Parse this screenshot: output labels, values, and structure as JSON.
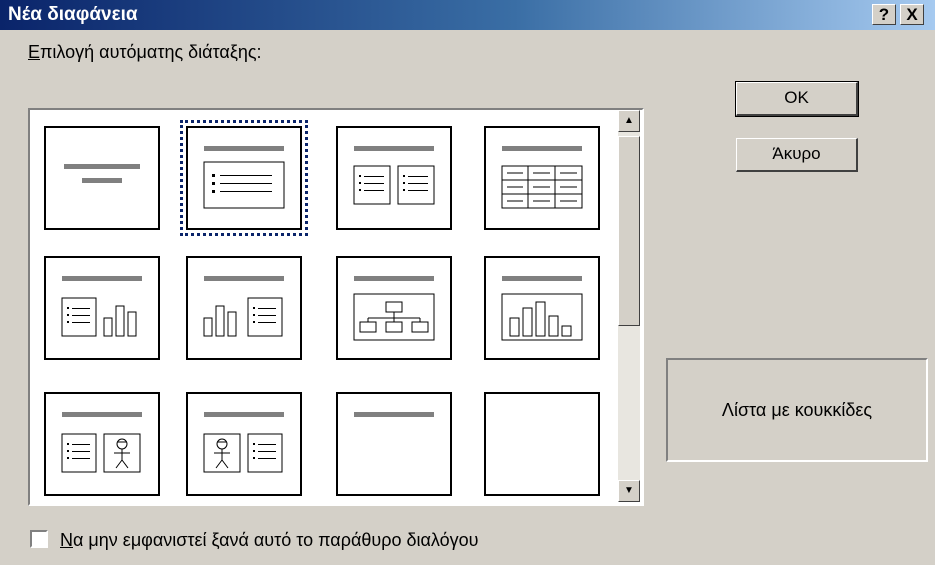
{
  "dialog": {
    "title": "Νέα διαφάνεια",
    "help_glyph": "?",
    "close_glyph": "X",
    "layout_label_accel": "Ε",
    "layout_label_rest": "πιλογή αυτόματης διάταξης:",
    "ok_label": "OK",
    "cancel_label": "Άκυρο",
    "selected_layout_name": "Λίστα με κουκκίδες",
    "checkbox_checked": false,
    "checkbox_label_accel": "Ν",
    "checkbox_label_rest": "α μην εμφανιστεί ξανά αυτό το παράθυρο διαλόγου"
  },
  "layouts": [
    {
      "kind": "title-slide",
      "selected": false
    },
    {
      "kind": "bulleted-list",
      "selected": true
    },
    {
      "kind": "two-column-text",
      "selected": false
    },
    {
      "kind": "table",
      "selected": false
    },
    {
      "kind": "text-and-chart",
      "selected": false
    },
    {
      "kind": "chart-and-text",
      "selected": false
    },
    {
      "kind": "organization-chart",
      "selected": false
    },
    {
      "kind": "chart",
      "selected": false
    },
    {
      "kind": "text-and-clip-art",
      "selected": false
    },
    {
      "kind": "clip-art-and-text",
      "selected": false
    },
    {
      "kind": "title-only",
      "selected": false
    },
    {
      "kind": "blank",
      "selected": false
    }
  ],
  "scrollbar": {
    "up_glyph": "▲",
    "down_glyph": "▼"
  }
}
